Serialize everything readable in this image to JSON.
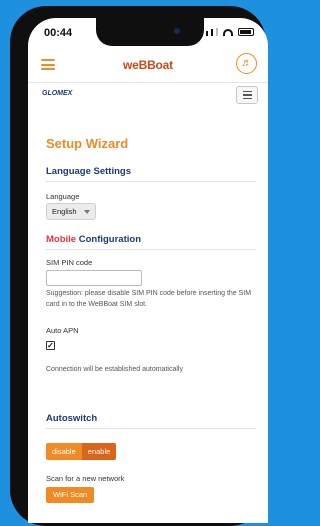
{
  "status_bar": {
    "time": "00:44"
  },
  "header": {
    "logo_text": "weBBoat",
    "brand_small": "GLOMEX"
  },
  "page": {
    "title": "Setup Wizard"
  },
  "language": {
    "section_title": "Language Settings",
    "label": "Language",
    "selected": "English"
  },
  "mobile": {
    "title_accent": "Mobile",
    "title_rest": " Configuration",
    "pin_label": "SIM PIN code",
    "pin_value": "",
    "pin_help": "Suggestion: please disable SIM PIN code before inserting the SIM card in to the WeBBoat SIM slot.",
    "apn_label": "Auto APN",
    "apn_checked": "✓",
    "connection_note": "Connection will be established automatically"
  },
  "autoswitch": {
    "section_title": "Autoswitch",
    "disable_label": "disable",
    "enable_label": "enable",
    "scan_label": "Scan for a new network",
    "wifi_scan_button": "WiFi Scan"
  },
  "colors": {
    "accent": "#f08a24",
    "heading": "#1b3a7a",
    "mobile_red": "#e8353a",
    "background": "#1e90e0"
  }
}
